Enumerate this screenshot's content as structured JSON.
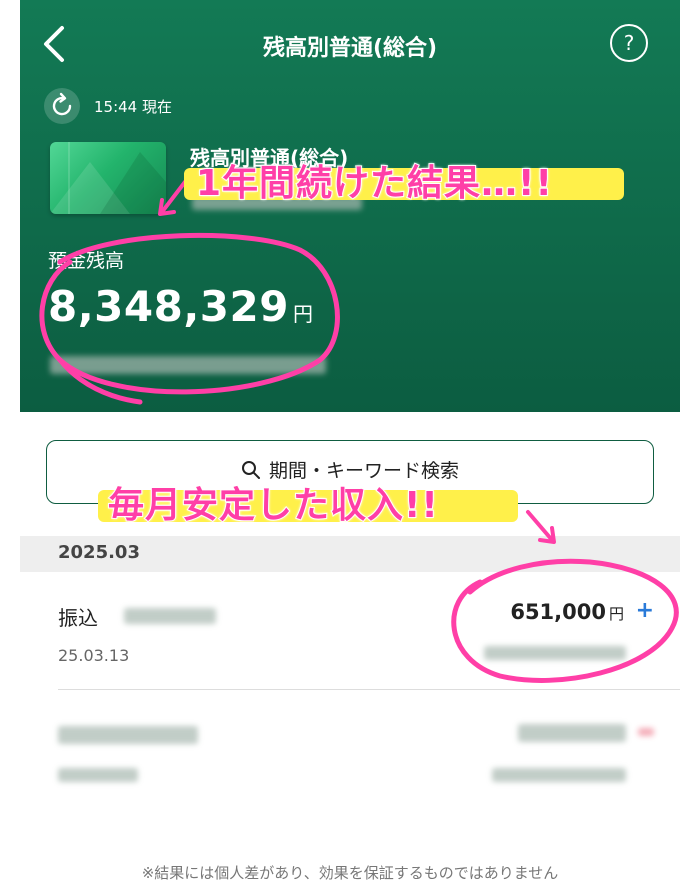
{
  "header": {
    "title": "残高別普通(総合)",
    "help_label": "?",
    "timestamp": "15:44 現在",
    "account_name": "残高別普通(総合)",
    "balance_label": "預金残高",
    "balance": "8,348,329",
    "currency": "円"
  },
  "search": {
    "label": "期間・キーワード検索"
  },
  "transactions": {
    "month": "2025.03",
    "items": [
      {
        "type": "振込",
        "date": "25.03.13",
        "amount": "651,000",
        "currency": "円",
        "sign": "+"
      }
    ]
  },
  "annotations": {
    "top": "1年間続けた結果…!!",
    "middle": "毎月安定した収入!!"
  },
  "disclaimer": "※結果には個人差があり、効果を保証するものではありません",
  "colors": {
    "header_green": "#0f6a4a",
    "annotation_pink": "#ff3fa7",
    "highlight_yellow": "#fff04a",
    "plus_blue": "#2a7ad8"
  }
}
